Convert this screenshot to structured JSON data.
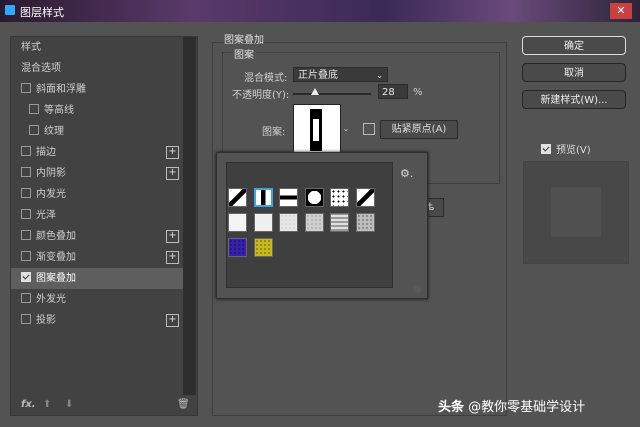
{
  "window": {
    "title": "图层样式",
    "close": "✕"
  },
  "left": {
    "items": [
      {
        "label": "样式",
        "checkbox": false,
        "checked": false,
        "sub": false,
        "plus": false,
        "selected": false
      },
      {
        "label": "混合选项",
        "checkbox": false,
        "checked": false,
        "sub": false,
        "plus": false,
        "selected": false
      },
      {
        "label": "斜面和浮雕",
        "checkbox": true,
        "checked": false,
        "sub": false,
        "plus": false,
        "selected": false
      },
      {
        "label": "等高线",
        "checkbox": true,
        "checked": false,
        "sub": true,
        "plus": false,
        "selected": false
      },
      {
        "label": "纹理",
        "checkbox": true,
        "checked": false,
        "sub": true,
        "plus": false,
        "selected": false
      },
      {
        "label": "描边",
        "checkbox": true,
        "checked": false,
        "sub": false,
        "plus": true,
        "selected": false
      },
      {
        "label": "内阴影",
        "checkbox": true,
        "checked": false,
        "sub": false,
        "plus": true,
        "selected": false
      },
      {
        "label": "内发光",
        "checkbox": true,
        "checked": false,
        "sub": false,
        "plus": false,
        "selected": false
      },
      {
        "label": "光泽",
        "checkbox": true,
        "checked": false,
        "sub": false,
        "plus": false,
        "selected": false
      },
      {
        "label": "颜色叠加",
        "checkbox": true,
        "checked": false,
        "sub": false,
        "plus": true,
        "selected": false
      },
      {
        "label": "渐变叠加",
        "checkbox": true,
        "checked": false,
        "sub": false,
        "plus": true,
        "selected": false
      },
      {
        "label": "图案叠加",
        "checkbox": true,
        "checked": true,
        "sub": false,
        "plus": false,
        "selected": true
      },
      {
        "label": "外发光",
        "checkbox": true,
        "checked": false,
        "sub": false,
        "plus": false,
        "selected": false
      },
      {
        "label": "投影",
        "checkbox": true,
        "checked": false,
        "sub": false,
        "plus": true,
        "selected": false
      }
    ],
    "fx": "fx.",
    "up": "⬆",
    "down": "⬇",
    "trash": "🗑"
  },
  "panel": {
    "group_title": "图案叠加",
    "sub_title": "图案",
    "blend_label": "混合模式:",
    "blend_value": "正片叠底",
    "opacity_label": "不透明度(Y):",
    "opacity_value": "28",
    "percent": "%",
    "opacity_fraction": 0.28,
    "pattern_label": "图案:",
    "snap_button": "贴紧原点(A)",
    "hidden_button_fragment": "ѣ",
    "gear": "⚙."
  },
  "swatches": [
    {
      "name": "diagonal-stripe",
      "bg": "#ffffff",
      "fg": "#000000"
    },
    {
      "name": "vertical-bar",
      "bg": "#ffffff",
      "fg": "#000000",
      "selected": true
    },
    {
      "name": "horizontal-bar",
      "bg": "#ffffff",
      "fg": "#000000"
    },
    {
      "name": "black-frame",
      "bg": "#000000",
      "fg": "#ffffff"
    },
    {
      "name": "dots",
      "bg": "#ffffff",
      "fg": "#000000"
    },
    {
      "name": "diagonal-thick",
      "bg": "#ffffff",
      "fg": "#000000"
    },
    {
      "name": "white-1",
      "bg": "#f4f4f4",
      "fg": "#f4f4f4"
    },
    {
      "name": "white-2",
      "bg": "#f0f0f0",
      "fg": "#f0f0f0"
    },
    {
      "name": "light-noise",
      "bg": "#e6e6e6",
      "fg": "#d0d0d0"
    },
    {
      "name": "gray-noise",
      "bg": "#cfcfcf",
      "fg": "#a8a8a8"
    },
    {
      "name": "concentric-squares",
      "bg": "#9a9a9a",
      "fg": "#e0e0e0"
    },
    {
      "name": "dark-noise",
      "bg": "#bdbdbd",
      "fg": "#6a6a6a"
    },
    {
      "name": "purple-noise",
      "bg": "#3820a8",
      "fg": "#1a1070"
    },
    {
      "name": "yellow-noise",
      "bg": "#c7b820",
      "fg": "#7a6e10"
    }
  ],
  "right": {
    "ok": "确定",
    "cancel": "取消",
    "new_style": "新建样式(W)...",
    "preview_label": "预览(V)",
    "preview_checked": true
  },
  "watermark": {
    "app": "头条",
    "handle": "@教你零基础学设计"
  }
}
